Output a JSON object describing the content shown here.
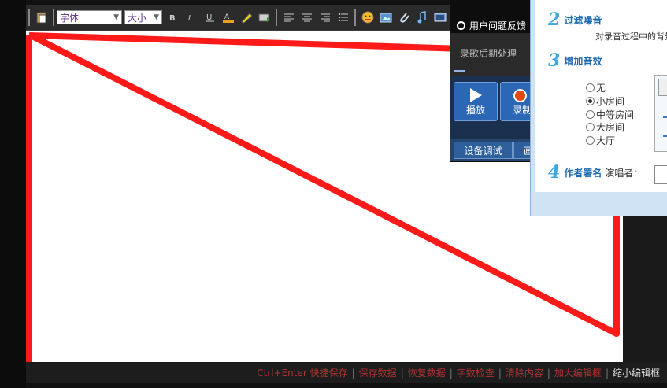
{
  "toolbar": {
    "font_select": "字体",
    "size_select": "大小"
  },
  "status_bar": {
    "items": [
      "Ctrl+Enter 快捷保存",
      "保存数据",
      "恢复数据",
      "字数检查",
      "清除内容",
      "加大编辑框",
      "缩小编辑框"
    ]
  },
  "recording": {
    "feedback": "用户问题反馈",
    "post_processing": "录歌后期处理",
    "play_label": "播放",
    "record_label": "录制",
    "device_debug": "设备调试",
    "second_tab": "画"
  },
  "settings": {
    "step2_num": "2",
    "step2_title": "过滤噪音",
    "step2_sub": "对录音过程中的背景",
    "step3_num": "3",
    "step3_title": "增加音效",
    "effects": [
      "无",
      "小房间",
      "中等房间",
      "大房间",
      "大厅"
    ],
    "effects_selected": "小房间",
    "step4_num": "4",
    "step4_title": "作者署名",
    "author_label": "演唱者："
  },
  "colors": {
    "annotation": "#ff1a1a",
    "accent_blue": "#2b67b4",
    "record_red": "#e04a10"
  }
}
